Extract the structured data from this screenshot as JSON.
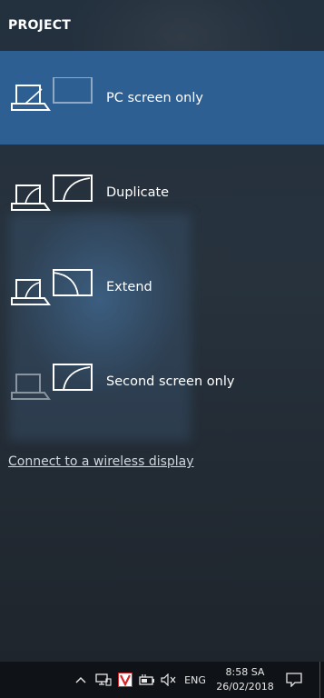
{
  "panel": {
    "title": "PROJECT",
    "options": [
      {
        "label": "PC screen only",
        "selected": true,
        "icon": "pc-screen-only-icon"
      },
      {
        "label": "Duplicate",
        "selected": false,
        "icon": "duplicate-icon"
      },
      {
        "label": "Extend",
        "selected": false,
        "icon": "extend-icon"
      },
      {
        "label": "Second screen only",
        "selected": false,
        "icon": "second-screen-only-icon"
      }
    ],
    "wireless_link": "Connect to a wireless display"
  },
  "taskbar": {
    "language": "ENG",
    "time": "8:58 SA",
    "date": "26/02/2018",
    "tray_icons": [
      "chevron-up-icon",
      "network-icon",
      "antivirus-icon",
      "battery-icon",
      "volume-muted-icon",
      "notification-icon"
    ]
  },
  "colors": {
    "selected_bg": "#2e5f93",
    "taskbar_bg": "#0f1216",
    "antivirus_red": "#d9252a"
  }
}
